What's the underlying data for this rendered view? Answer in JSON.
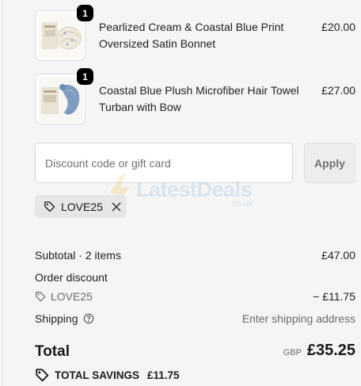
{
  "cart": {
    "items": [
      {
        "name": "Pearlized Cream & Coastal Blue Print Oversized Satin Bonnet",
        "price": "£20.00",
        "quantity": "1",
        "thumb_icon": "satin-bonnet-product-image",
        "thumb_color": "#efe9dd"
      },
      {
        "name": "Coastal Blue Plush Microfiber Hair Towel Turban with Bow",
        "price": "£27.00",
        "quantity": "1",
        "thumb_icon": "hair-towel-product-image",
        "thumb_color": "#7f9cc0"
      }
    ]
  },
  "discount": {
    "placeholder": "Discount code or gift card",
    "value": "",
    "apply_label": "Apply",
    "applied_code": "LOVE25"
  },
  "watermark": {
    "logo": "LatestDeals",
    "sub": ".co.uk"
  },
  "summary": {
    "subtotal_label": "Subtotal · 2 items",
    "subtotal_value": "£47.00",
    "order_discount_label": "Order discount",
    "discount_code": "LOVE25",
    "discount_value": "− £11.75",
    "shipping_label": "Shipping",
    "shipping_value": "Enter shipping address",
    "total_label": "Total",
    "currency": "GBP",
    "total_value": "£35.25",
    "savings_label": "TOTAL SAVINGS",
    "savings_value": "£11.75"
  }
}
